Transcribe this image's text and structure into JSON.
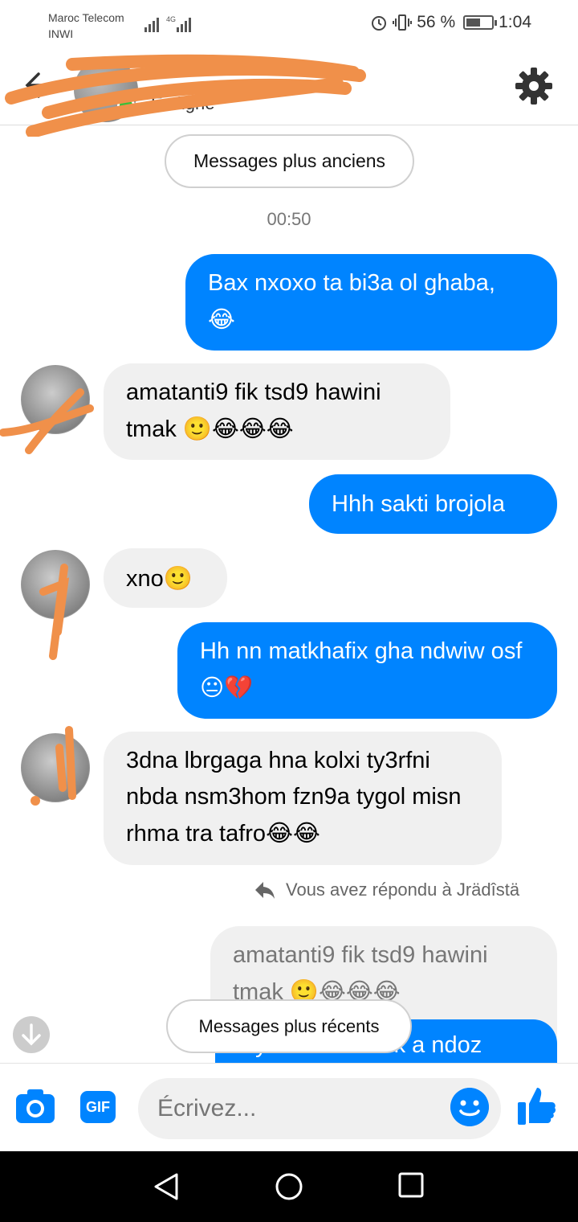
{
  "status_bar": {
    "carrier_1": "Maroc Telecom",
    "carrier_2": "INWI",
    "network": "4G",
    "battery_percent": "56 %",
    "battery_level": 0.56,
    "time": "1:04"
  },
  "header": {
    "status": "En ligne",
    "back_icon": "arrow-left-icon",
    "settings_icon": "gear-icon"
  },
  "conversation": {
    "older_button": "Messages plus anciens",
    "timestamp": "00:50",
    "messages": [
      {
        "direction": "out",
        "text": "Bax nxoxo ta bi3a ol ghaba,",
        "emoji": "😂"
      },
      {
        "direction": "in",
        "text": "amatanti9 fik tsd9 hawini tmak",
        "emoji": "🙂😂😂😂"
      },
      {
        "direction": "out",
        "text": "Hhh sakti brojola",
        "emoji": ""
      },
      {
        "direction": "in",
        "text": "xno",
        "emoji": "🙂"
      },
      {
        "direction": "out",
        "text": "Hh nn matkhafix gha ndwiw osf",
        "emoji": "😐💔"
      },
      {
        "direction": "in",
        "text": "3dna lbrgaga hna kolxi ty3rfni nbda nsm3hom fzn9a tygol misn rhma tra tafro",
        "emoji": "😂😂"
      }
    ],
    "reply_notice": "Vous avez répondu à Jrädîstä",
    "quoted_text": "amatanti9 fik tsd9 hawini tmak",
    "quoted_emoji": "🙂😂😂😂",
    "partial_reply": "Ty brb mahnwik a ndoz",
    "newer_button": "Messages plus récents"
  },
  "composer": {
    "placeholder": "Écrivez...",
    "gif_label": "GIF"
  },
  "colors": {
    "accent": "#0084ff",
    "incoming_bubble": "#f0f0f0",
    "online": "#3ac03a",
    "scribble": "#f0904a"
  }
}
